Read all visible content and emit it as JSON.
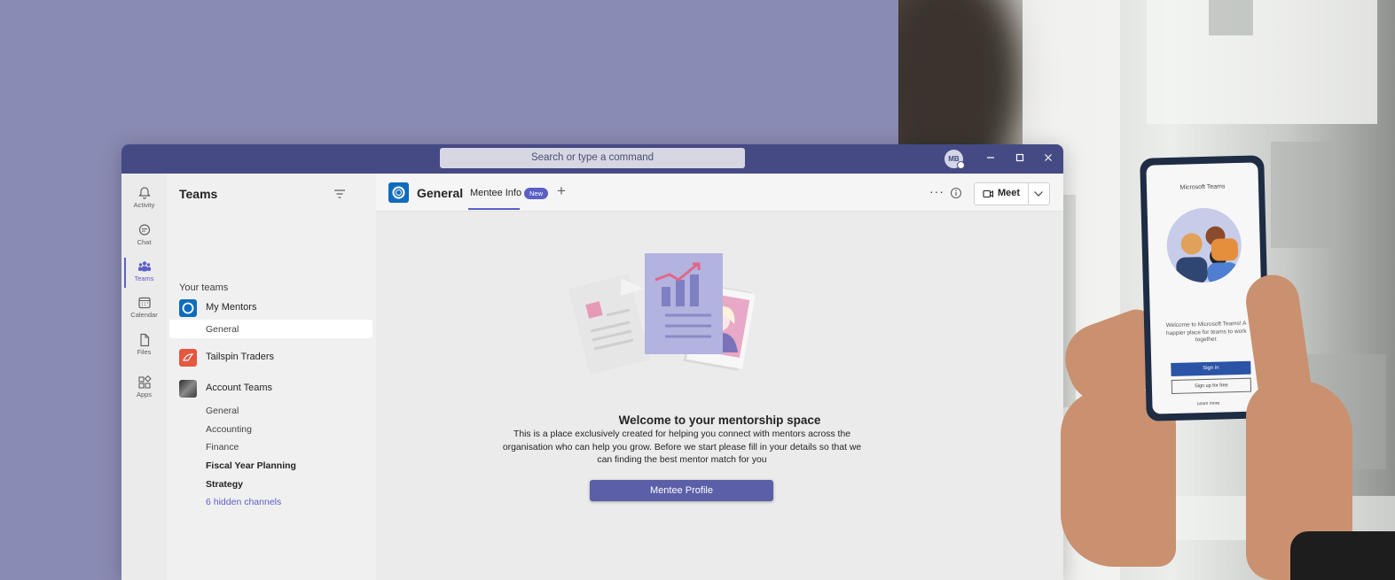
{
  "titlebar": {
    "search_placeholder": "Search or type a command",
    "avatar_initials": "MB"
  },
  "rail": [
    {
      "label": "Activity",
      "icon": "bell-icon"
    },
    {
      "label": "Chat",
      "icon": "chat-icon"
    },
    {
      "label": "Teams",
      "icon": "teams-icon",
      "active": true
    },
    {
      "label": "Calendar",
      "icon": "calendar-icon"
    },
    {
      "label": "Files",
      "icon": "file-icon"
    },
    {
      "label": "Apps",
      "icon": "apps-icon"
    }
  ],
  "panel": {
    "title": "Teams",
    "section_label": "Your teams",
    "teams": [
      {
        "name": "My Mentors",
        "channels": [
          "General"
        ]
      },
      {
        "name": "Tailspin Traders",
        "channels": []
      },
      {
        "name": "Account Teams",
        "channels": [
          "General",
          "Accounting",
          "Finance",
          "Fiscal Year Planning",
          "Strategy"
        ]
      }
    ],
    "hidden_channels": "6 hidden channels"
  },
  "channel_header": {
    "title": "General",
    "tab_label": "Mentee Info",
    "tab_badge": "New",
    "add_tab": "+",
    "more": "···",
    "meet_label": "Meet"
  },
  "welcome": {
    "title": "Welcome to your mentorship space",
    "body": "This is a place exclusively created for helping you connect with mentors across the organisation who can help you grow. Before we start please fill in your details so that we can finding the best mentor match for you",
    "button": "Mentee Profile"
  },
  "phone": {
    "app_title": "Microsoft Teams",
    "welcome_text": "Welcome to Microsoft Teams! A happier place for teams to work together.",
    "signin": "Sign in",
    "signup": "Sign up for free",
    "learn_more": "Learn more"
  },
  "colors": {
    "background": "#8a8bb4",
    "titlebar": "#454a85",
    "accent": "#5b5fc7",
    "button": "#5b5fa8"
  }
}
